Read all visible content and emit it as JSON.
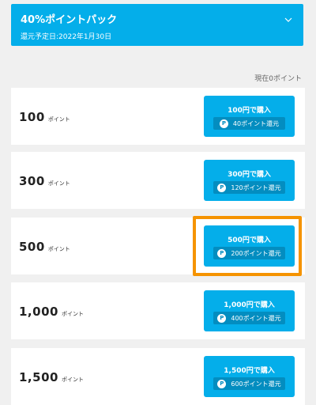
{
  "banner": {
    "title": "40%ポイントパック",
    "subtitle": "還元予定日:2022年1月30日",
    "chevron_icon": "chevron-down-icon"
  },
  "current_points": "現在0ポイント",
  "point_unit": "ポイント",
  "point_icon_glyph": "P",
  "packs": [
    {
      "points": "100",
      "buy_label": "100円で購入",
      "reward": "40ポイント還元"
    },
    {
      "points": "300",
      "buy_label": "300円で購入",
      "reward": "120ポイント還元"
    },
    {
      "points": "500",
      "buy_label": "500円で購入",
      "reward": "200ポイント還元"
    },
    {
      "points": "1,000",
      "buy_label": "1,000円で購入",
      "reward": "400ポイント還元"
    },
    {
      "points": "1,500",
      "buy_label": "1,500円で購入",
      "reward": "600ポイント還元"
    }
  ],
  "highlight_color": "#f59300",
  "accent_color": "#04aeea"
}
